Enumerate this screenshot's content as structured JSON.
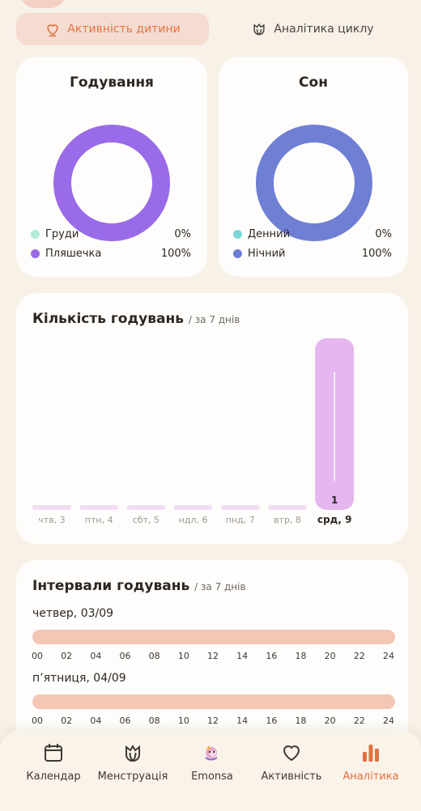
{
  "tabs": {
    "child_activity": "Активність дитини",
    "cycle_analytics": "Аналітика циклу"
  },
  "feeding": {
    "title": "Годування",
    "legend": [
      {
        "label": "Груди",
        "value": "0%",
        "color": "#b2ecd8"
      },
      {
        "label": "Пляшечка",
        "value": "100%",
        "color": "#9a6be8"
      }
    ],
    "chart_data": {
      "type": "pie",
      "categories": [
        "Груди",
        "Пляшечка"
      ],
      "values": [
        0,
        100
      ],
      "colors": [
        "#b2ecd8",
        "#9a6be8"
      ]
    }
  },
  "sleep": {
    "title": "Сон",
    "legend": [
      {
        "label": "Денний",
        "value": "0%",
        "color": "#7fd8d8"
      },
      {
        "label": "Нічний",
        "value": "100%",
        "color": "#6f7fd4"
      }
    ],
    "chart_data": {
      "type": "pie",
      "categories": [
        "Денний",
        "Нічний"
      ],
      "values": [
        0,
        100
      ],
      "colors": [
        "#7fd8d8",
        "#6f7fd4"
      ]
    }
  },
  "feeding_count": {
    "title": "Кількість годувань",
    "subtitle": "/ за 7 днів",
    "chart_data": {
      "type": "bar",
      "categories": [
        "чтв, 3",
        "птн, 4",
        "сбт, 5",
        "ндл, 6",
        "пнд, 7",
        "втр, 8",
        "срд, 9"
      ],
      "values": [
        0,
        0,
        0,
        0,
        0,
        0,
        1
      ],
      "data_labels": [
        "",
        "",
        "",
        "",
        "",
        "",
        "1"
      ],
      "highlighted": "срд, 9",
      "ylim": [
        0,
        1
      ]
    }
  },
  "intervals": {
    "title": "Інтервали годувань",
    "subtitle": "/ за 7 днів",
    "hours": [
      "00",
      "02",
      "04",
      "06",
      "08",
      "10",
      "12",
      "14",
      "16",
      "18",
      "20",
      "22",
      "24"
    ],
    "days": [
      {
        "label": "четвер, 03/09"
      },
      {
        "label": "п’ятниця, 04/09"
      }
    ]
  },
  "bottom_nav": [
    {
      "label": "Календар",
      "icon": "calendar-icon"
    },
    {
      "label": "Менструація",
      "icon": "tulip-icon"
    },
    {
      "label": "Emonsa",
      "icon": "emonsa-avatar-icon"
    },
    {
      "label": "Активність",
      "icon": "heart-icon"
    },
    {
      "label": "Аналітика",
      "icon": "bar-chart-icon",
      "active": true
    }
  ],
  "colors": {
    "accent": "#e2703f",
    "background": "#f7f1e8",
    "interval_bar": "#f4c6b4",
    "bar_inactive": "#f1def3",
    "bar_active": "#e6b6f0"
  }
}
